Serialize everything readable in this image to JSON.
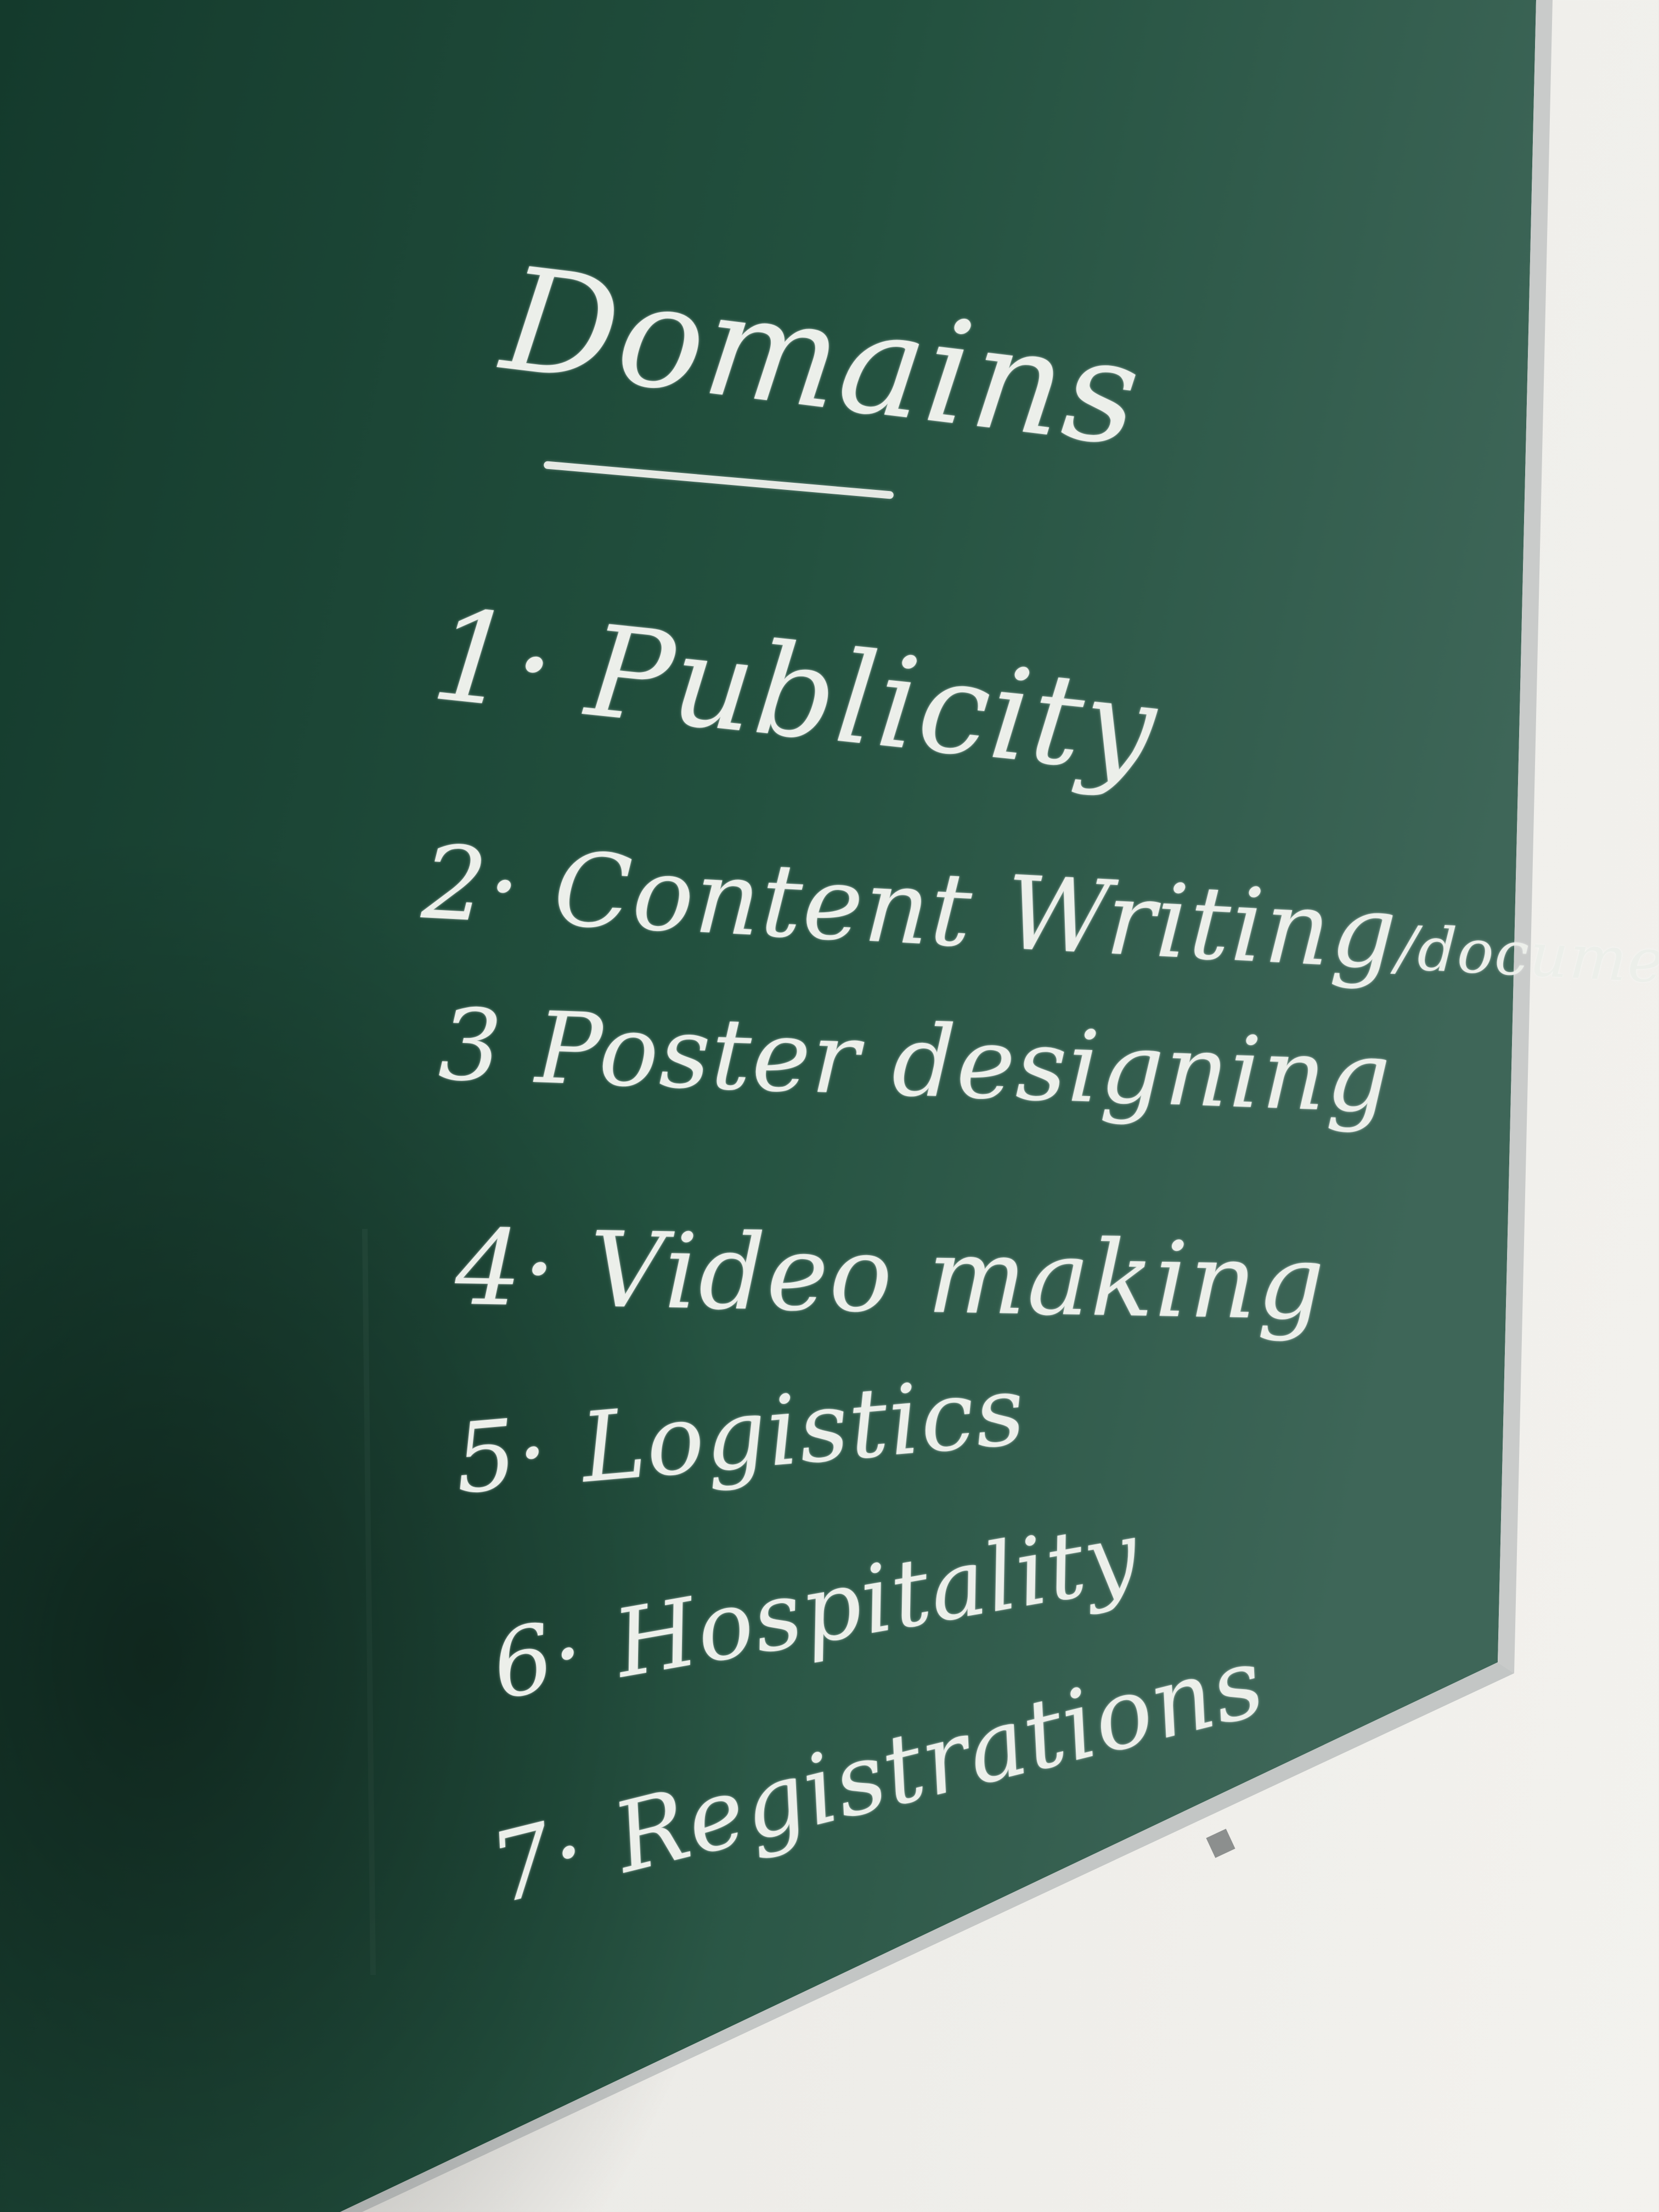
{
  "board": {
    "title": "Domains",
    "items": [
      {
        "num": "1·",
        "label": "Publicity"
      },
      {
        "num": "2·",
        "label": "Content Writing",
        "extra": "/documentation"
      },
      {
        "num": "3",
        "label": "Poster designing"
      },
      {
        "num": "4·",
        "label": "Video making"
      },
      {
        "num": "5·",
        "label": "Logistics"
      },
      {
        "num": "6·",
        "label": "Hospitality"
      },
      {
        "num": "7·",
        "label": "Registrations"
      }
    ]
  },
  "colors": {
    "board": "#1f4a3a",
    "chalk": "#ecefea",
    "wall": "#ecebe7",
    "frame": "#b9bcbb"
  }
}
